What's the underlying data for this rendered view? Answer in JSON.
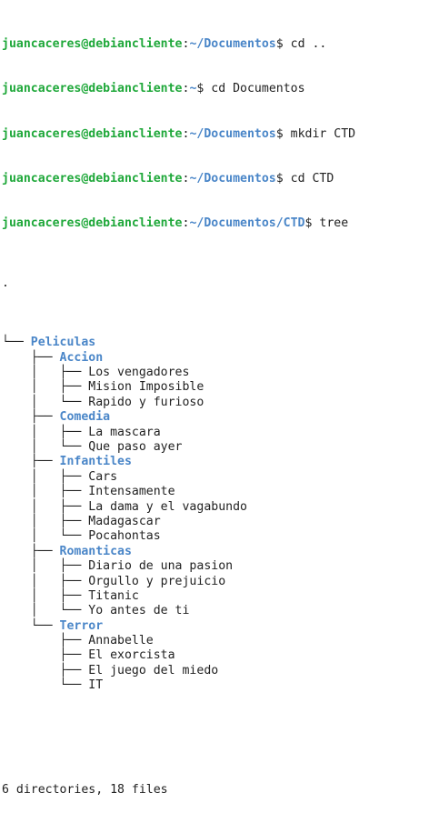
{
  "prompt": {
    "user_host": "juancaceres@debiancliente",
    "sep": ":",
    "dollar": "$ "
  },
  "lines": [
    {
      "path": "~/Documentos",
      "cmd": "cd ..",
      "partial": true
    },
    {
      "path": "~",
      "cmd": "cd Documentos"
    },
    {
      "path": "~/Documentos",
      "cmd": "mkdir CTD"
    },
    {
      "path": "~/Documentos",
      "cmd": "cd CTD"
    },
    {
      "path": "~/Documentos/CTD",
      "cmd": "tree"
    }
  ],
  "tree_root": ".",
  "tree": [
    {
      "prefix": "└── ",
      "name": "Peliculas",
      "dir": true
    },
    {
      "prefix": "    ├── ",
      "name": "Accion",
      "dir": true
    },
    {
      "prefix": "    │   ├── ",
      "name": "Los vengadores"
    },
    {
      "prefix": "    │   ├── ",
      "name": "Mision Imposible"
    },
    {
      "prefix": "    │   └── ",
      "name": "Rapido y furioso"
    },
    {
      "prefix": "    ├── ",
      "name": "Comedia",
      "dir": true
    },
    {
      "prefix": "    │   ├── ",
      "name": "La mascara"
    },
    {
      "prefix": "    │   └── ",
      "name": "Que paso ayer"
    },
    {
      "prefix": "    ├── ",
      "name": "Infantiles",
      "dir": true
    },
    {
      "prefix": "    │   ├── ",
      "name": "Cars"
    },
    {
      "prefix": "    │   ├── ",
      "name": "Intensamente"
    },
    {
      "prefix": "    │   ├── ",
      "name": "La dama y el vagabundo"
    },
    {
      "prefix": "    │   ├── ",
      "name": "Madagascar"
    },
    {
      "prefix": "    │   └── ",
      "name": "Pocahontas"
    },
    {
      "prefix": "    ├── ",
      "name": "Romanticas",
      "dir": true
    },
    {
      "prefix": "    │   ├── ",
      "name": "Diario de una pasion"
    },
    {
      "prefix": "    │   ├── ",
      "name": "Orgullo y prejuicio"
    },
    {
      "prefix": "    │   ├── ",
      "name": "Titanic"
    },
    {
      "prefix": "    │   └── ",
      "name": "Yo antes de ti"
    },
    {
      "prefix": "    └── ",
      "name": "Terror",
      "dir": true
    },
    {
      "prefix": "        ├── ",
      "name": "Annabelle"
    },
    {
      "prefix": "        ├── ",
      "name": "El exorcista"
    },
    {
      "prefix": "        ├── ",
      "name": "El juego del miedo"
    },
    {
      "prefix": "        └── ",
      "name": "IT"
    }
  ],
  "summary": "6 directories, 18 files",
  "colors": {
    "user": "#1fa83a",
    "path": "#4a86c8",
    "text": "#222222",
    "background": "#ffffff"
  }
}
